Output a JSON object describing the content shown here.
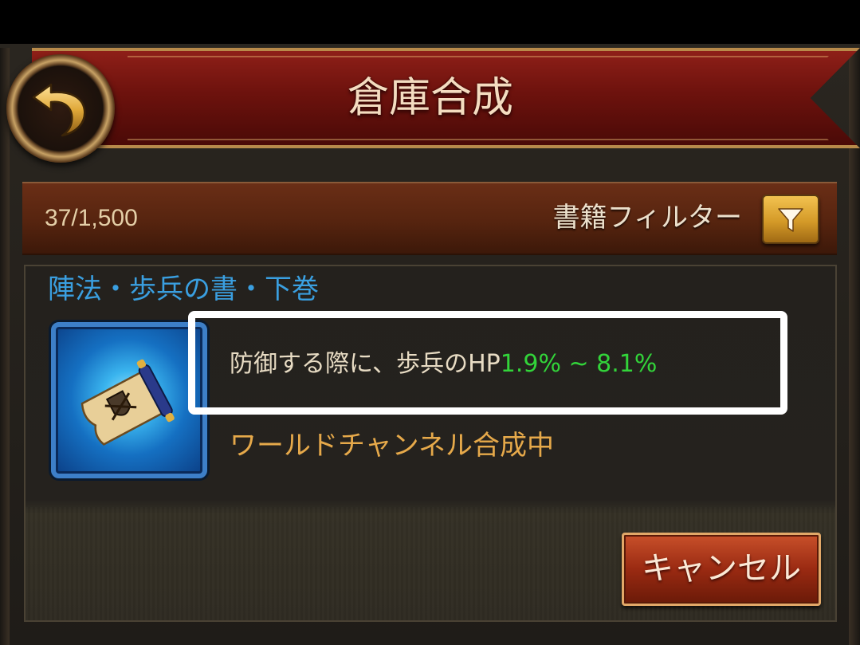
{
  "header": {
    "title": "倉庫合成",
    "back_icon": "back-arrow-icon"
  },
  "info_bar": {
    "capacity": "37/1,500",
    "filter_label": "書籍フィルター",
    "filter_icon": "filter-funnel-icon"
  },
  "item": {
    "name": "陣法・歩兵の書・下巻",
    "icon": "scroll-icon",
    "effect_text": "防御する際に、歩兵のHP",
    "effect_range": "1.9% ~ 8.1%",
    "status": "ワールドチャンネル合成中"
  },
  "actions": {
    "cancel_label": "キャンセル"
  },
  "colors": {
    "banner": "#6d120d",
    "book_name": "#3a9fe0",
    "effect_range": "#32d43a",
    "status": "#e6a94a",
    "highlight_border": "#ffffff"
  }
}
